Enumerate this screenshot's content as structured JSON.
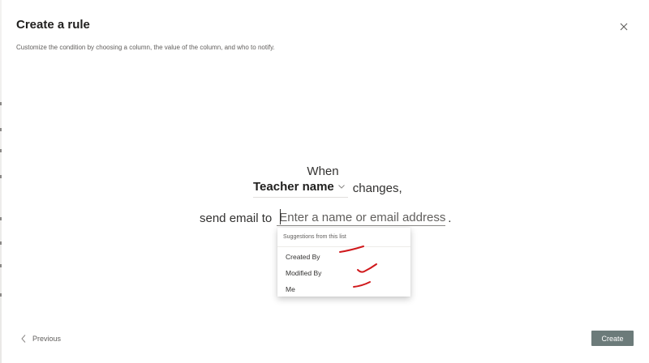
{
  "dialog": {
    "title": "Create a rule",
    "subtitle": "Customize the condition by choosing a column, the value of the column, and who to notify."
  },
  "rule": {
    "when_text": "When",
    "column_value": "Teacher name",
    "changes_text": "changes,",
    "send_text": "send email to",
    "email_placeholder": "Enter a name or email address",
    "period": "."
  },
  "suggestions": {
    "header": "Suggestions from this list",
    "items": [
      "Created By",
      "Modified By",
      "Me"
    ]
  },
  "footer": {
    "previous_label": "Previous",
    "create_label": "Create"
  },
  "icons": {
    "close": "close-icon",
    "chevron": "chevron-down-icon",
    "previous": "chevron-left-icon"
  },
  "colors": {
    "create_button": "#6c7b7a",
    "annotation_marks": "#d0191c"
  }
}
